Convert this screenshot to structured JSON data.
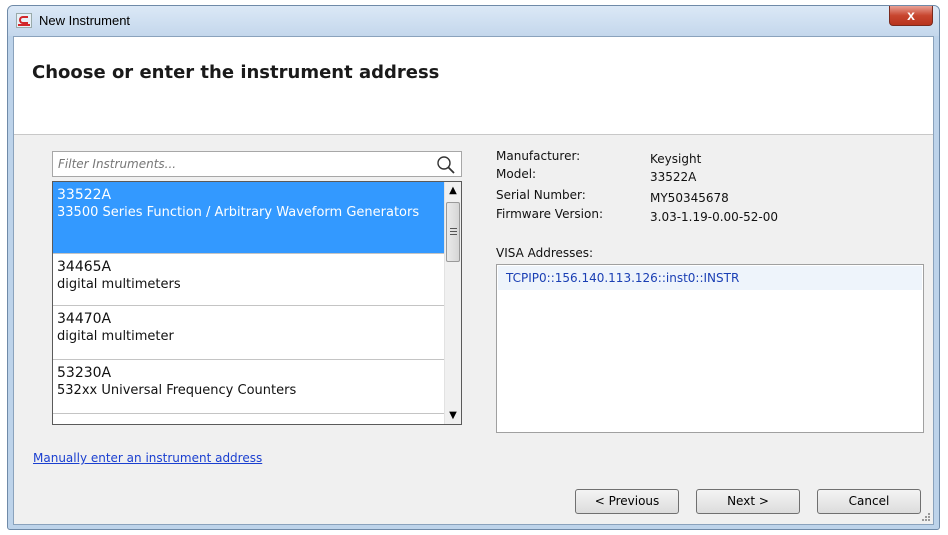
{
  "window": {
    "title": "New Instrument",
    "close_symbol": "x"
  },
  "header": {
    "title": "Choose or enter the instrument address"
  },
  "filter": {
    "placeholder": "Filter Instruments..."
  },
  "instruments": [
    {
      "model": "33522A",
      "description": "33500 Series Function / Arbitrary Waveform Generators",
      "selected": true
    },
    {
      "model": "34465A",
      "description": "digital multimeters",
      "selected": false
    },
    {
      "model": "34470A",
      "description": "digital multimeter",
      "selected": false
    },
    {
      "model": "53230A",
      "description": "532xx Universal Frequency Counters",
      "selected": false
    },
    {
      "model": "",
      "description": "",
      "selected": false
    }
  ],
  "details": {
    "manufacturer_label": "Manufacturer:",
    "manufacturer_value": "Keysight",
    "model_label": "Model:",
    "model_value": "33522A",
    "serial_label": "Serial Number:",
    "serial_value": "MY50345678",
    "firmware_label": "Firmware Version:",
    "firmware_value": "3.03-1.19-0.00-52-00",
    "visa_label": "VISA Addresses:",
    "visa_addresses": [
      "TCPIP0::156.140.113.126::inst0::INSTR"
    ]
  },
  "links": {
    "manual": "Manually enter an instrument address"
  },
  "buttons": {
    "previous": "< Previous",
    "next": "Next >",
    "cancel": "Cancel"
  },
  "colors": {
    "selection": "#3399ff",
    "link": "#1a3fd0",
    "visa_text": "#1a3fb4"
  }
}
